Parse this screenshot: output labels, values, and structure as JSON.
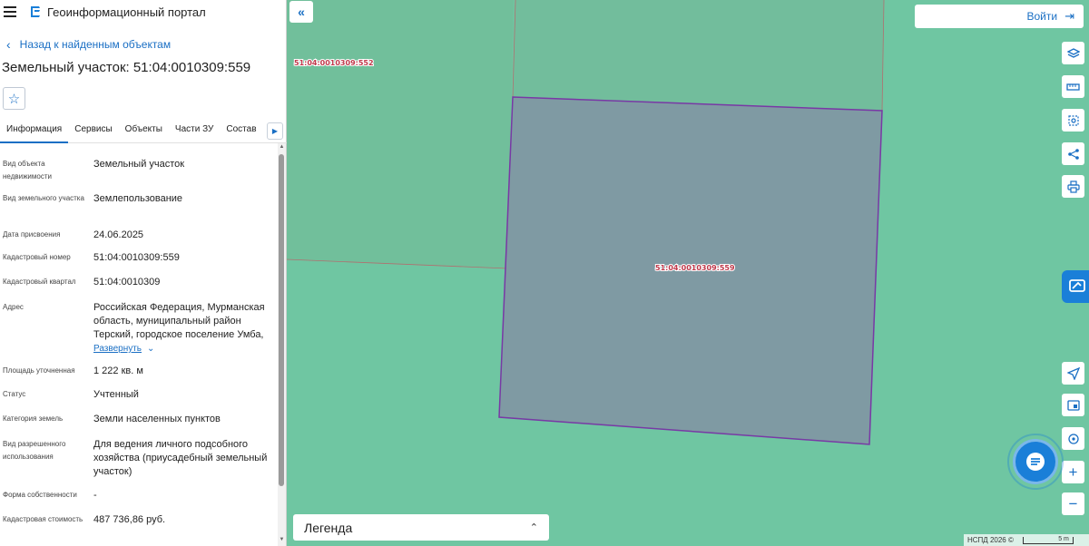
{
  "header": {
    "app_title": "Геоинформационный портал"
  },
  "nav": {
    "back_label": "Назад к найденным объектам"
  },
  "object": {
    "title": "Земельный участок: 51:04:0010309:559"
  },
  "tabs": [
    {
      "label": "Информация",
      "active": true
    },
    {
      "label": "Сервисы"
    },
    {
      "label": "Объекты"
    },
    {
      "label": "Части ЗУ"
    },
    {
      "label": "Состав"
    }
  ],
  "properties": [
    {
      "label": "Вид объекта недвижимости",
      "value": "Земельный участок"
    },
    {
      "label": "Вид земельного участка",
      "value": "Землепользование"
    },
    {
      "label": "Дата присвоения",
      "value": "24.06.2025"
    },
    {
      "label": "Кадастровый номер",
      "value": "51:04:0010309:559"
    },
    {
      "label": "Кадастровый квартал",
      "value": "51:04:0010309"
    },
    {
      "label": "Адрес",
      "value": "Российская Федерация, Мурманская область, муниципальный район Терский, городское поселение Умба,",
      "expand_label": "Развернуть"
    },
    {
      "label": "Площадь уточненная",
      "value": "1 222 кв. м"
    },
    {
      "label": "Статус",
      "value": "Учтенный"
    },
    {
      "label": "Категория земель",
      "value": "Земли населенных пунктов"
    },
    {
      "label": "Вид разрешенного использования",
      "value": "Для ведения личного подсобного хозяйства (приусадебный земельный участок)"
    },
    {
      "label": "Форма собственности",
      "value": "-"
    },
    {
      "label": "Кадастровая стоимость",
      "value": "487 736,86 руб."
    }
  ],
  "map": {
    "login_label": "Войти",
    "legend_label": "Легенда",
    "parcel_labels": [
      "51:04:0010309:552",
      "51:04:0010309:559"
    ],
    "copyright": "НСПД 2026 ©",
    "scale_label": "5 m",
    "colors": {
      "map_bg": "#6fc6a2",
      "selected_fill": "#7f9aa0",
      "selected_stroke": "#7a2aa6",
      "accent": "#1a6fc4"
    }
  },
  "tools": {
    "layers": "layers-icon",
    "ruler": "ruler-icon",
    "select": "select-area-icon",
    "share": "share-icon",
    "print": "print-icon",
    "locate": "locate-icon",
    "minimap": "minimap-icon",
    "geolocation": "geolocation-icon",
    "zoom_in": "+",
    "zoom_out": "−"
  }
}
